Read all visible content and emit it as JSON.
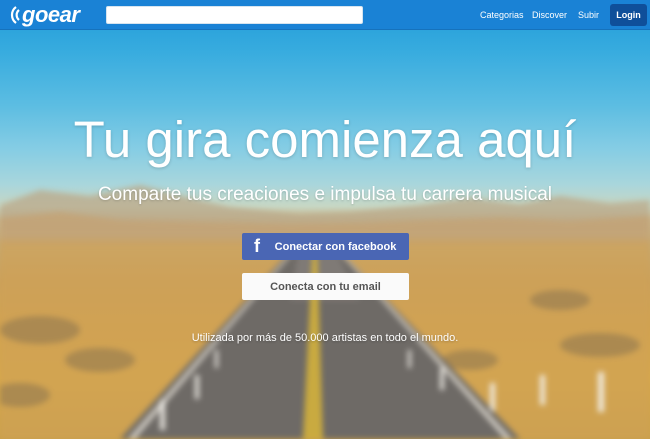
{
  "brand": {
    "logo_text": "goear",
    "color": "#1a82d5"
  },
  "search": {
    "value": "",
    "placeholder": ""
  },
  "nav": {
    "categorias": "Categorias",
    "discover": "Discover",
    "subir": "Subir",
    "login": "Login"
  },
  "hero": {
    "headline": "Tu gira comienza aquí",
    "subline": "Comparte tus creaciones e impulsa tu carrera musical",
    "facebook_button": "Conectar con facebook",
    "facebook_icon_glyph": "f",
    "email_button": "Conecta con tu email",
    "footnote": "Utilizada por más de 50.000 artistas en todo el mundo."
  },
  "colors": {
    "topbar": "#1a82d5",
    "login_button": "#0f4f9a",
    "facebook_button": "#4a66b4",
    "email_button": "#fafafa"
  },
  "icons": [
    "goear-logo-icon",
    "facebook-icon"
  ]
}
